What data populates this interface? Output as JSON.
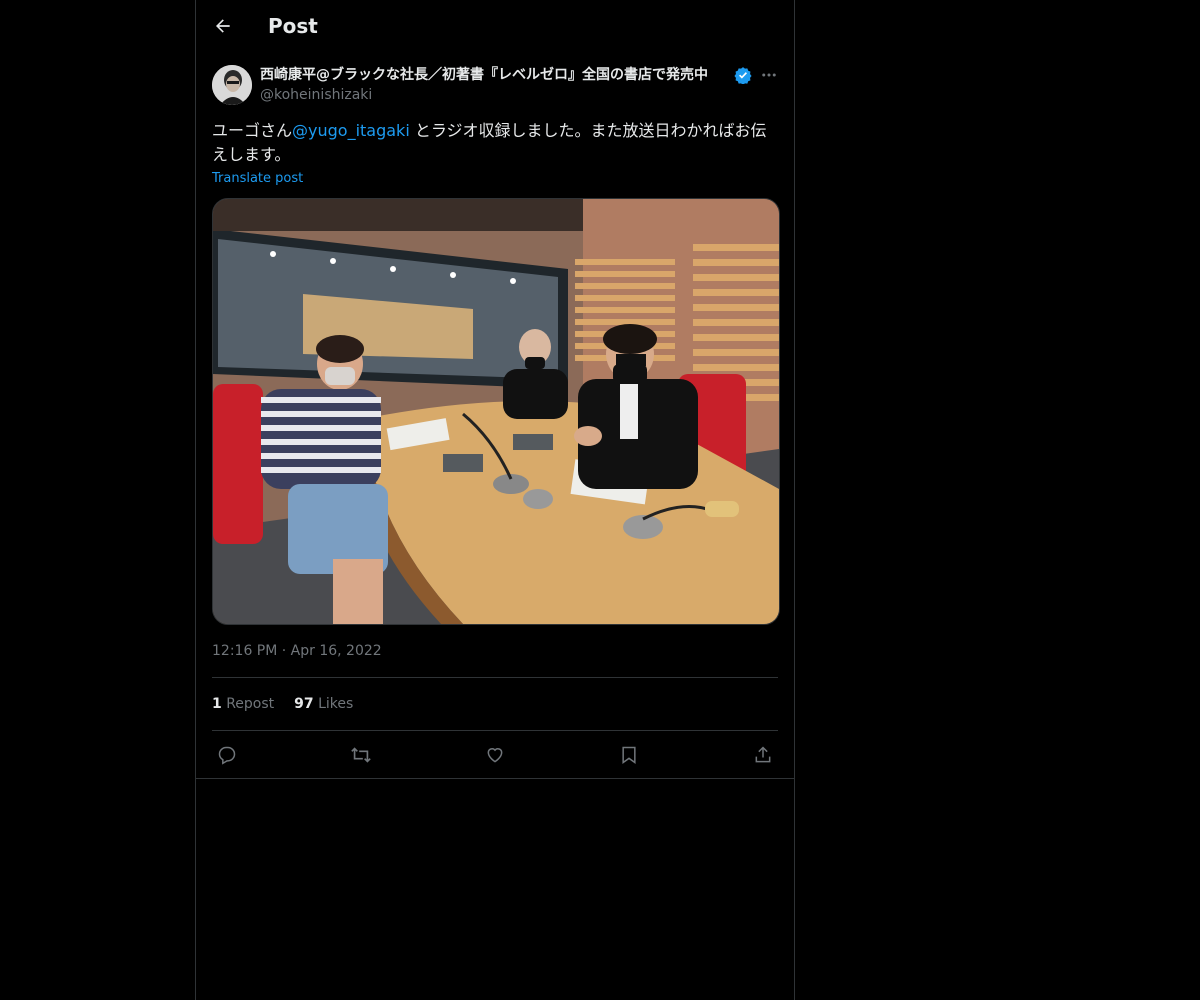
{
  "header": {
    "title": "Post",
    "back_icon": "arrow-left-icon"
  },
  "author": {
    "display_name": "西崎康平@ブラックな社長／初著書『レベルゼロ』全国の書店で発売中",
    "handle": "@koheinishizaki",
    "verified_icon": "verified-badge-icon",
    "more_icon": "more-horizontal-icon"
  },
  "post": {
    "text_before": "ユーゴさん",
    "mention": "@yugo_itagaki",
    "text_after": " とラジオ収録しました。また放送日わかればお伝えします。",
    "translate_label": "Translate post",
    "timestamp": "12:16 PM · Apr 16, 2022"
  },
  "stats": {
    "reposts_count": "1",
    "reposts_label": "Repost",
    "likes_count": "97",
    "likes_label": "Likes"
  },
  "actions": [
    "reply-icon",
    "repost-icon",
    "like-icon",
    "bookmark-icon",
    "share-icon"
  ],
  "colors": {
    "accent": "#1d9bf0",
    "muted": "#71767b",
    "border": "#2f3336",
    "background": "#000000"
  }
}
